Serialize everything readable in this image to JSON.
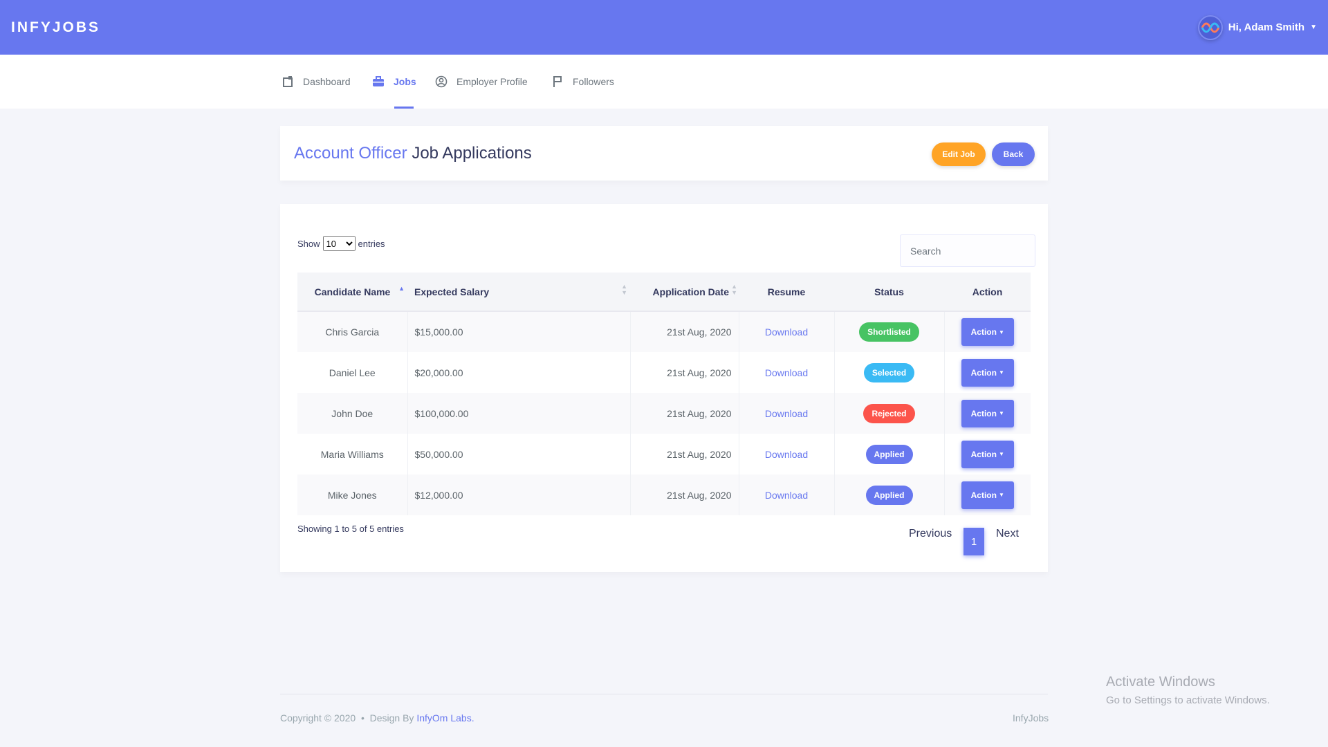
{
  "app": {
    "brand": "INFYJOBS",
    "greeting": "Hi, Adam Smith"
  },
  "nav": {
    "items": [
      {
        "label": "Dashboard",
        "icon": "clipboard-icon"
      },
      {
        "label": "Jobs",
        "icon": "briefcase-icon",
        "active": true
      },
      {
        "label": "Employer Profile",
        "icon": "user-circle-icon"
      },
      {
        "label": "Followers",
        "icon": "flag-icon"
      }
    ]
  },
  "header": {
    "title_accent": "Account Officer",
    "title_rest": "Job Applications",
    "edit_label": "Edit Job",
    "back_label": "Back"
  },
  "table": {
    "show_label": "Show",
    "entries_label": "entries",
    "page_size": "10",
    "search_placeholder": "Search",
    "columns": [
      "Candidate Name",
      "Expected Salary",
      "Application Date",
      "Resume",
      "Status",
      "Action"
    ],
    "rows": [
      {
        "name": "Chris Garcia",
        "salary": "$15,000.00",
        "date": "21st Aug, 2020",
        "resume": "Download",
        "status": "Shortlisted",
        "action": "Action"
      },
      {
        "name": "Daniel Lee",
        "salary": "$20,000.00",
        "date": "21st Aug, 2020",
        "resume": "Download",
        "status": "Selected",
        "action": "Action"
      },
      {
        "name": "John Doe",
        "salary": "$100,000.00",
        "date": "21st Aug, 2020",
        "resume": "Download",
        "status": "Rejected",
        "action": "Action"
      },
      {
        "name": "Maria Williams",
        "salary": "$50,000.00",
        "date": "21st Aug, 2020",
        "resume": "Download",
        "status": "Applied",
        "action": "Action"
      },
      {
        "name": "Mike Jones",
        "salary": "$12,000.00",
        "date": "21st Aug, 2020",
        "resume": "Download",
        "status": "Applied",
        "action": "Action"
      }
    ],
    "info": "Showing 1 to 5 of 5 entries",
    "pagination": {
      "prev": "Previous",
      "current": "1",
      "next": "Next"
    }
  },
  "status_colors": {
    "Shortlisted": "#47c363",
    "Selected": "#3abaf4",
    "Rejected": "#fc544b",
    "Applied": "#6777ef"
  },
  "colors": {
    "primary": "#6777ef",
    "warning": "#ffa426"
  },
  "footer": {
    "copyright": "Copyright © 2020",
    "bullet": "•",
    "design_by": "Design By",
    "company": "InfyOm Labs.",
    "right": "InfyJobs"
  },
  "watermark": {
    "title": "Activate Windows",
    "subtitle": "Go to Settings to activate Windows."
  }
}
